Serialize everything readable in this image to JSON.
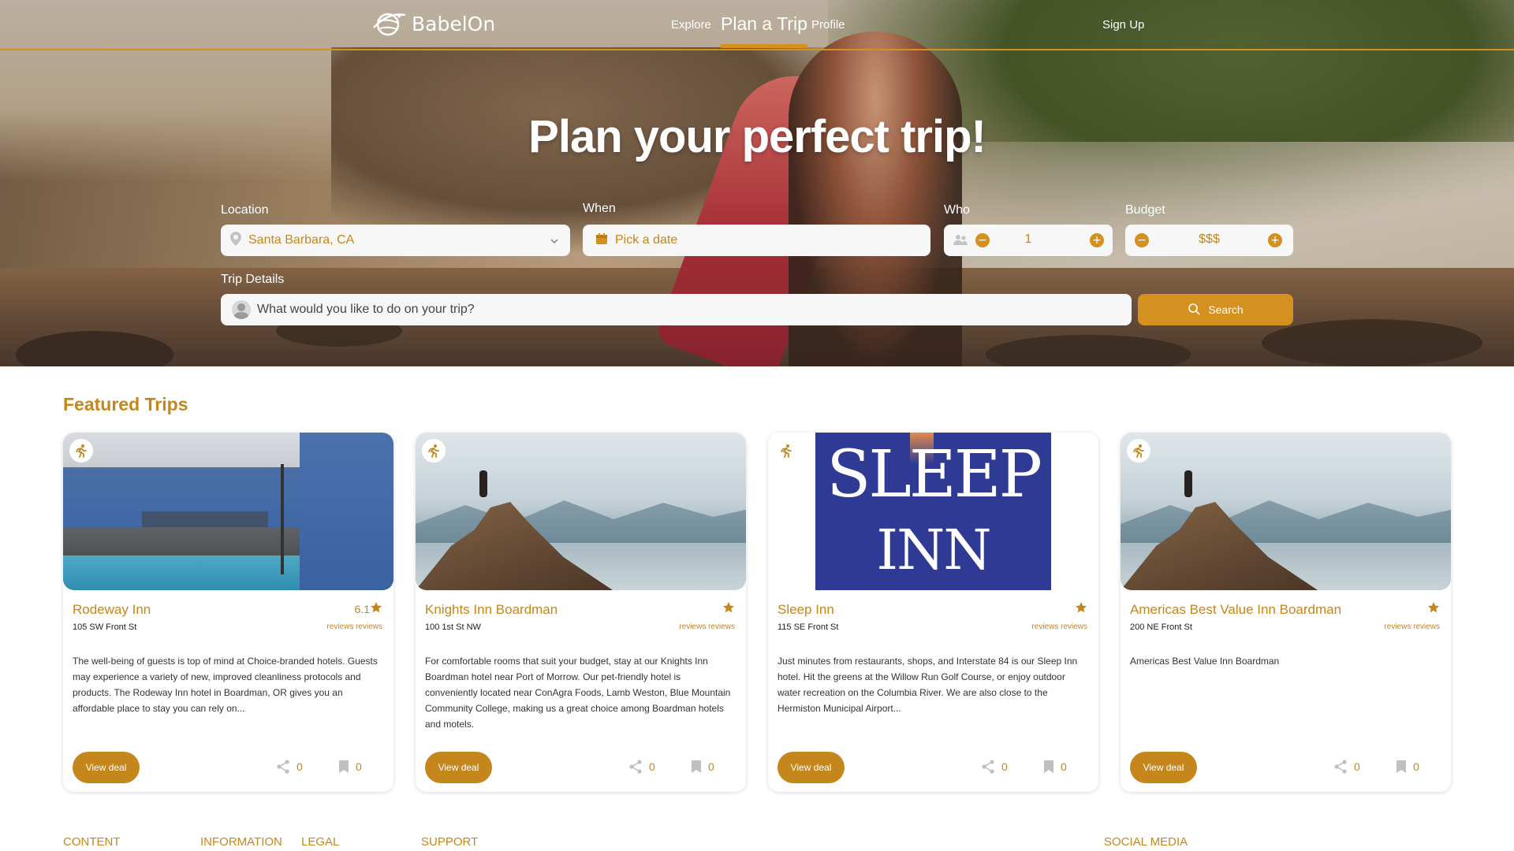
{
  "header": {
    "logo_text": "BabelOn",
    "nav": {
      "explore": "Explore",
      "plan_a_trip": "Plan a Trip",
      "profile": "Profile",
      "sign_up": "Sign Up"
    }
  },
  "hero": {
    "title": "Plan your perfect trip!",
    "location": {
      "label": "Location",
      "value": "Santa Barbara, CA"
    },
    "when": {
      "label": "When",
      "placeholder": "Pick a date"
    },
    "who": {
      "label": "Who",
      "value": "1"
    },
    "budget": {
      "label": "Budget",
      "value": "$$$"
    },
    "details": {
      "label": "Trip Details",
      "placeholder": "What would you like to do on your trip?"
    },
    "search_label": "Search"
  },
  "featured": {
    "title": "Featured Trips",
    "cards": [
      {
        "name": "Rodeway Inn",
        "address": "105 SW Front St",
        "rating": "6.1",
        "reviews": "reviews reviews",
        "description": "The well-being of guests is top of mind at Choice-branded hotels. Guests may experience a variety of new, improved cleanliness protocols and products. The Rodeway Inn hotel in Boardman, OR gives you an affordable place to stay you can rely on...",
        "deal_label": "View deal",
        "shares": "0",
        "saves": "0"
      },
      {
        "name": "Knights Inn Boardman",
        "address": "100 1st St NW",
        "rating": "",
        "reviews": "reviews reviews",
        "description": "For comfortable rooms that suit your budget, stay at our Knights Inn Boardman hotel near Port of Morrow. Our pet-friendly hotel is conveniently located near ConAgra Foods, Lamb Weston, Blue Mountain Community College, making us a great choice among Boardman hotels and motels.",
        "deal_label": "View deal",
        "shares": "0",
        "saves": "0"
      },
      {
        "name": "Sleep Inn",
        "address": "115 SE Front St",
        "rating": "",
        "reviews": "reviews reviews",
        "description": "Just minutes from restaurants, shops, and Interstate 84 is our Sleep Inn hotel. Hit the greens at the Willow Run Golf Course, or enjoy outdoor water recreation on the Columbia River. We are also close to the Hermiston Municipal Airport...",
        "deal_label": "View deal",
        "shares": "0",
        "saves": "0",
        "logo_line1": "SLEEP",
        "logo_line2": "INN"
      },
      {
        "name": "Americas Best Value Inn Boardman",
        "address": "200 NE Front St",
        "rating": "",
        "reviews": "reviews reviews",
        "description": "Americas Best Value Inn Boardman",
        "deal_label": "View deal",
        "shares": "0",
        "saves": "0"
      }
    ]
  },
  "footer": {
    "content": "CONTENT",
    "information": "INFORMATION",
    "legal": "LEGAL",
    "support": "SUPPORT",
    "social_media": "SOCIAL MEDIA"
  },
  "colors": {
    "accent": "#d4911f",
    "accent_text": "#c5861c",
    "sleep_inn_blue": "#2f3a94"
  }
}
